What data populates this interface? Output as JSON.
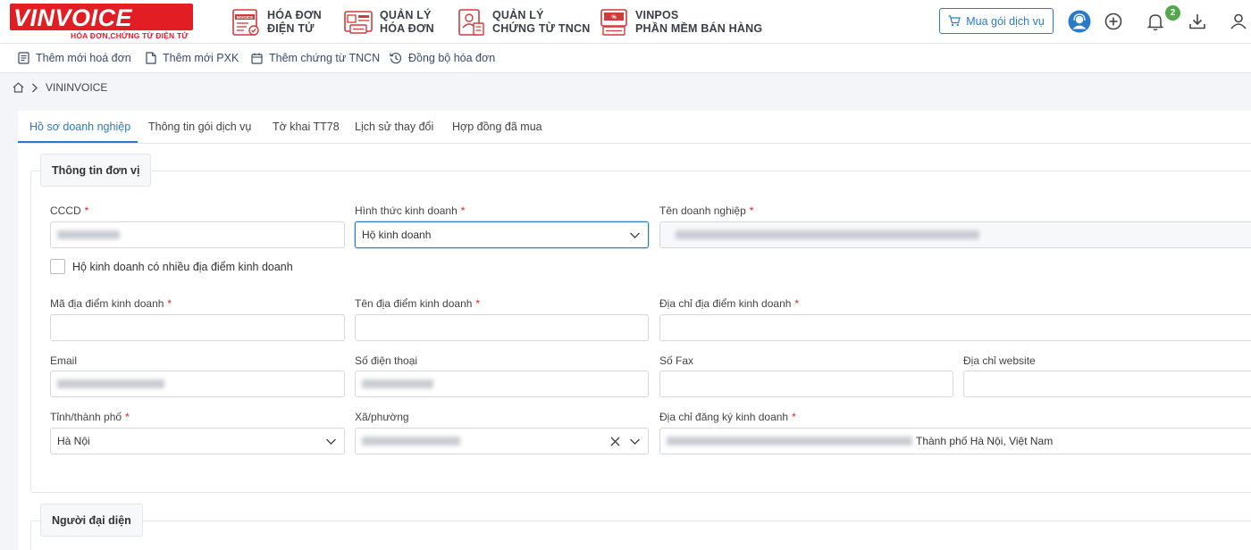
{
  "logo": {
    "brand": "VINVOICE",
    "tagline": "HÓA ĐƠN,CHỨNG TỪ ĐIỆN TỬ"
  },
  "nav_modules": [
    {
      "line1": "HÓA ĐƠN",
      "line2": "ĐIỆN TỬ",
      "icon": "invoice-icon"
    },
    {
      "line1": "QUẢN LÝ",
      "line2": "HÓA ĐƠN",
      "icon": "invoice-management-icon"
    },
    {
      "line1": "QUẢN LÝ",
      "line2": "CHỨNG TỪ TNCN",
      "icon": "tax-document-icon"
    },
    {
      "line1": "VINPOS",
      "line2": "PHẦN MỀM BÁN HÀNG",
      "icon": "pos-icon"
    }
  ],
  "header": {
    "buy_label": "Mua gói dịch vụ",
    "notification_count": "2"
  },
  "quick_actions": [
    {
      "label": "Thêm mới hoá đơn"
    },
    {
      "label": "Thêm mới PXK"
    },
    {
      "label": "Thêm chứng từ TNCN"
    },
    {
      "label": "Đồng bộ hóa đơn"
    }
  ],
  "breadcrumb": {
    "current": "VININVOICE"
  },
  "tabs": [
    {
      "label": "Hồ sơ doanh nghiệp",
      "active": true
    },
    {
      "label": "Thông tin gói dịch vụ"
    },
    {
      "label": "Tờ khai TT78"
    },
    {
      "label": "Lịch sử thay đổi"
    },
    {
      "label": "Hợp đồng đã mua"
    }
  ],
  "unit_section": {
    "legend": "Thông tin đơn vị",
    "fields": {
      "cccd": {
        "label": "CCCD",
        "required": "*",
        "value": ""
      },
      "business_type": {
        "label": "Hình thức kinh doanh",
        "required": "*",
        "value": "Hộ kinh doanh"
      },
      "company_name": {
        "label": "Tên doanh nghiệp",
        "required": "*",
        "value": ""
      },
      "multi_location": {
        "label": "Hộ kinh doanh có nhiều địa điểm kinh doanh",
        "checked": false
      },
      "location_code": {
        "label": "Mã địa điểm kinh doanh",
        "required": "*",
        "value": ""
      },
      "location_name": {
        "label": "Tên địa điểm kinh doanh",
        "required": "*",
        "value": ""
      },
      "location_address": {
        "label": "Địa chỉ địa điểm kinh doanh",
        "required": "*",
        "value": ""
      },
      "email": {
        "label": "Email",
        "value": ""
      },
      "phone": {
        "label": "Số điện thoại",
        "value": ""
      },
      "fax": {
        "label": "Số Fax",
        "value": ""
      },
      "website": {
        "label": "Địa chỉ website",
        "value": ""
      },
      "province": {
        "label": "Tỉnh/thành phố",
        "required": "*",
        "value": "Hà Nội"
      },
      "ward": {
        "label": "Xã/phường",
        "value": ""
      },
      "registered_address": {
        "label": "Địa chỉ đăng ký kinh doanh",
        "required": "*",
        "value_visible": "Thành phố Hà Nội, Việt Nam"
      }
    }
  },
  "representative_section": {
    "legend": "Người đại diện"
  },
  "colors": {
    "accent": "#2a7ac8",
    "brand": "#e21e24",
    "badge": "#52a84b"
  }
}
